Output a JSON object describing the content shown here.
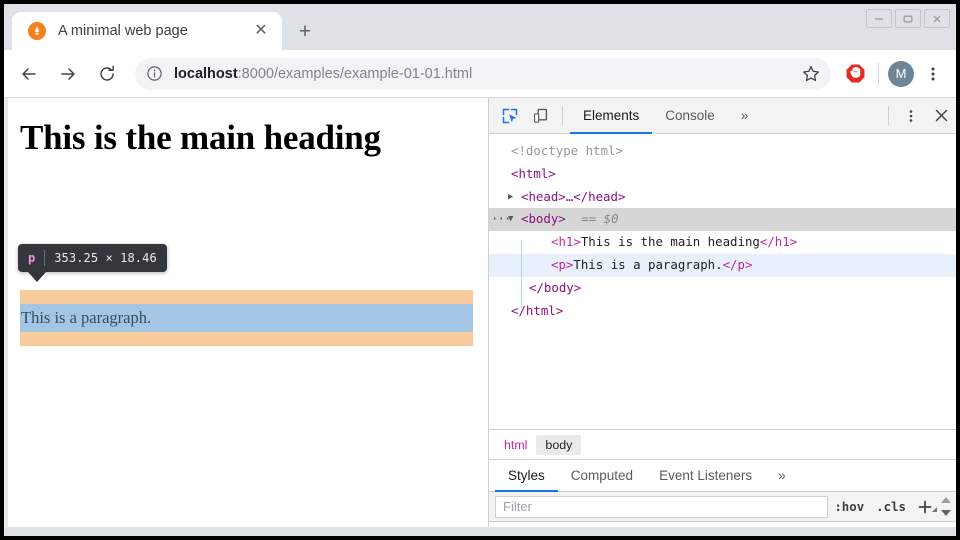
{
  "window": {
    "controls": [
      {
        "name": "minimize",
        "glyph": "minimize-icon"
      },
      {
        "name": "maximize",
        "glyph": "maximize-icon"
      },
      {
        "name": "close",
        "glyph": "close-icon"
      }
    ]
  },
  "tabstrip": {
    "tab_title": "A minimal web page",
    "favicon": "flame-favicon",
    "close_label": "✕",
    "newtab_label": "+"
  },
  "navbar": {
    "back_icon": "back-arrow-icon",
    "forward_icon": "forward-arrow-icon",
    "reload_icon": "reload-icon",
    "info_icon": "info-circle-icon",
    "url_host": "localhost",
    "url_rest": ":8000/examples/example-01-01.html",
    "url_full": "localhost:8000/examples/example-01-01.html",
    "star_icon": "bookmark-star-icon",
    "extension_icon": "adblock-stop-hand-icon",
    "avatar_initial": "M",
    "menu_icon": "kebab-menu-icon"
  },
  "viewport": {
    "heading": "This is the main heading",
    "paragraph": "This is a paragraph.",
    "highlight": {
      "margin_color": "#f8cb9d",
      "content_color": "#a3c5e6"
    },
    "tooltip": {
      "tag": "p",
      "dimensions": "353.25 × 18.46",
      "background": "#33373b",
      "tag_color": "#f58fe0"
    }
  },
  "devtools": {
    "toolbar": {
      "inspect_icon": "inspect-cursor-icon",
      "device_icon": "device-toolbar-icon",
      "tabs": [
        {
          "label": "Elements",
          "active": true
        },
        {
          "label": "Console",
          "active": false
        }
      ],
      "overflow_label": "»",
      "settings_icon": "kebab-menu-icon",
      "close_icon": "close-icon",
      "accent_color": "#1a73e8"
    },
    "dom_tree": [
      {
        "text": "<!doctype html>"
      },
      {
        "text": "<html>"
      },
      {
        "text": "<head>…</head>"
      },
      {
        "text": "<body>  == $0",
        "selected": "gray"
      },
      {
        "text": "<h1>This is the main heading</h1>"
      },
      {
        "text": "<p>This is a paragraph.</p>",
        "selected": "blue"
      },
      {
        "text": "</body>"
      },
      {
        "text": "</html>"
      }
    ],
    "dom_parts": {
      "doctype": "<!doctype html>",
      "html_open": "<html>",
      "head_collapsed": "<head>…</head>",
      "body_open": "<body>",
      "body_marker": "== $0",
      "h1_line": "<h1>This is the main heading</h1>",
      "h1_open": "<h1>",
      "h1_text": "This is the main heading",
      "h1_close": "</h1>",
      "p_open": "<p>",
      "p_text": "This is a paragraph.",
      "p_close": "</p>",
      "body_close": "</body>",
      "html_close": "</html>",
      "ellipsis": "···",
      "triangle_open": "▼",
      "triangle_closed": "▶"
    },
    "breadcrumb": [
      {
        "label": "html",
        "active": false
      },
      {
        "label": "body",
        "active": true
      }
    ],
    "styles_tabs": [
      {
        "label": "Styles",
        "active": true
      },
      {
        "label": "Computed",
        "active": false
      },
      {
        "label": "Event Listeners",
        "active": false
      }
    ],
    "styles_overflow": "»",
    "filter": {
      "placeholder": "Filter",
      "value": "",
      "hov_label": ":hov",
      "cls_label": ".cls",
      "new_rule_label": "+"
    }
  }
}
